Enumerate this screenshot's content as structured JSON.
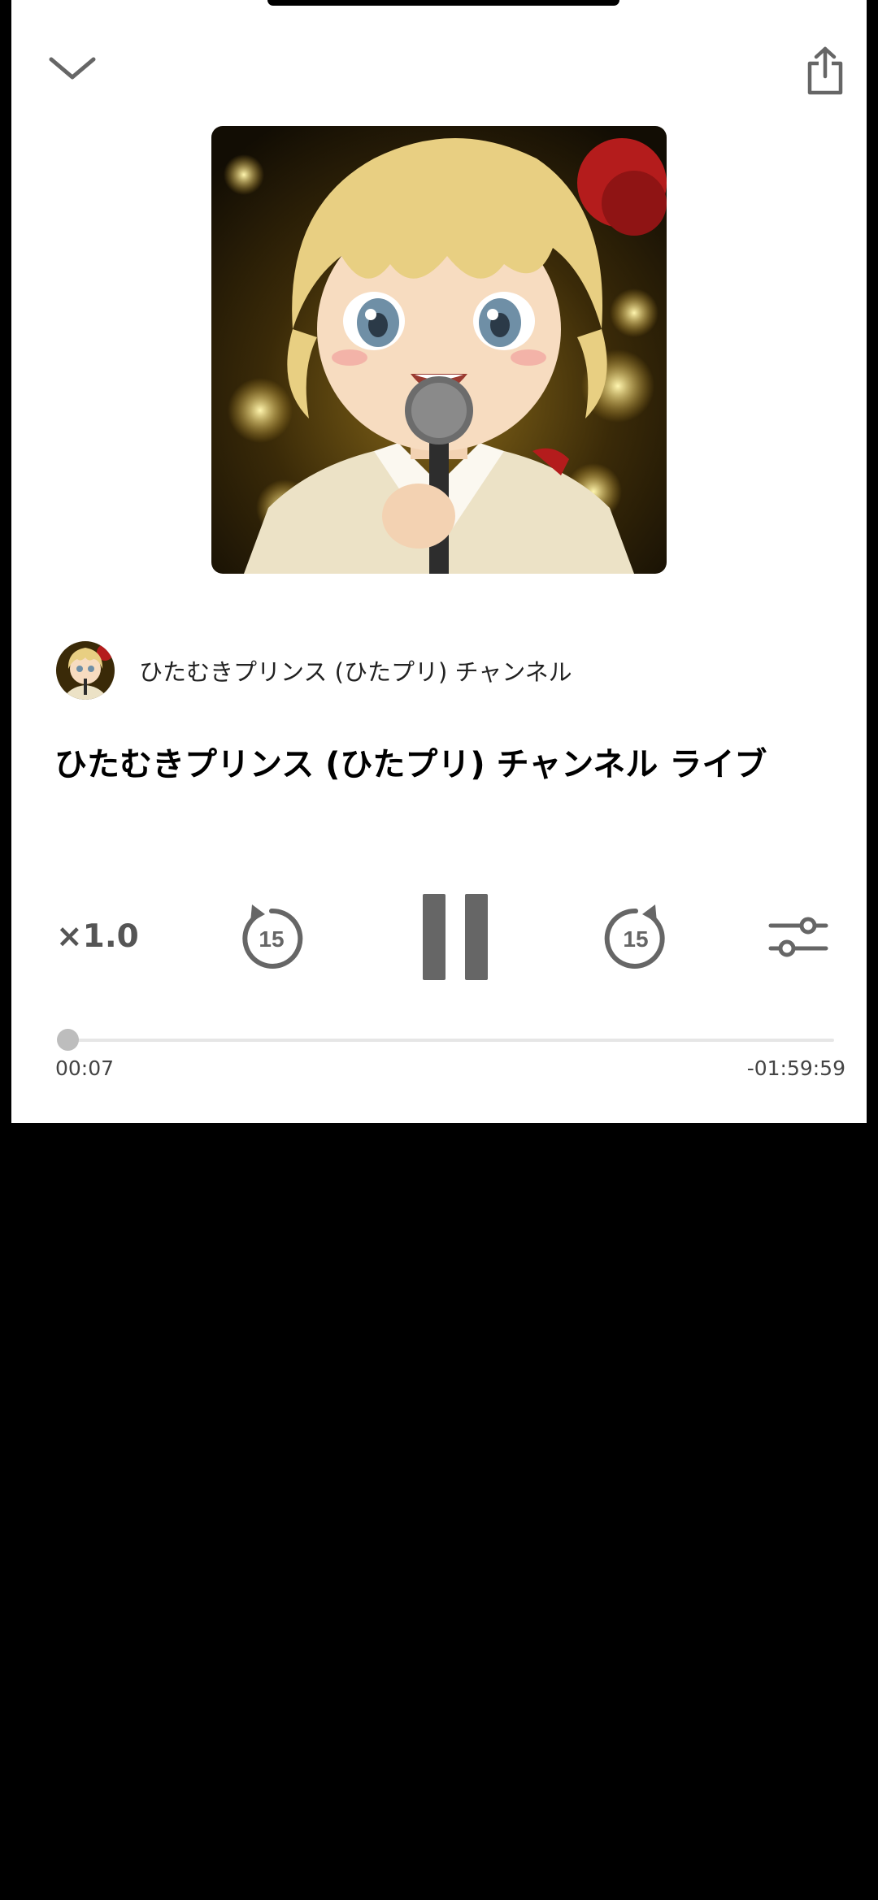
{
  "channel": {
    "name": "ひたむきプリンス (ひたプリ) チャンネル"
  },
  "episode": {
    "title": "ひたむきプリンス (ひたプリ) チャンネル ライブ"
  },
  "controls": {
    "speed_label": "×1.0",
    "rewind_seconds": "15",
    "forward_seconds": "15",
    "state": "playing"
  },
  "progress": {
    "elapsed": "00:07",
    "remaining": "-01:59:59",
    "fraction": 0.001
  },
  "icons": {
    "collapse": "chevron-down-icon",
    "share": "share-icon",
    "rewind": "rewind-15-icon",
    "pause": "pause-icon",
    "forward": "forward-15-icon",
    "settings": "sliders-icon"
  },
  "colors": {
    "control_gray": "#666666",
    "title": "#000000",
    "track": "#e6e6e6",
    "knob": "#bdbdbd"
  }
}
